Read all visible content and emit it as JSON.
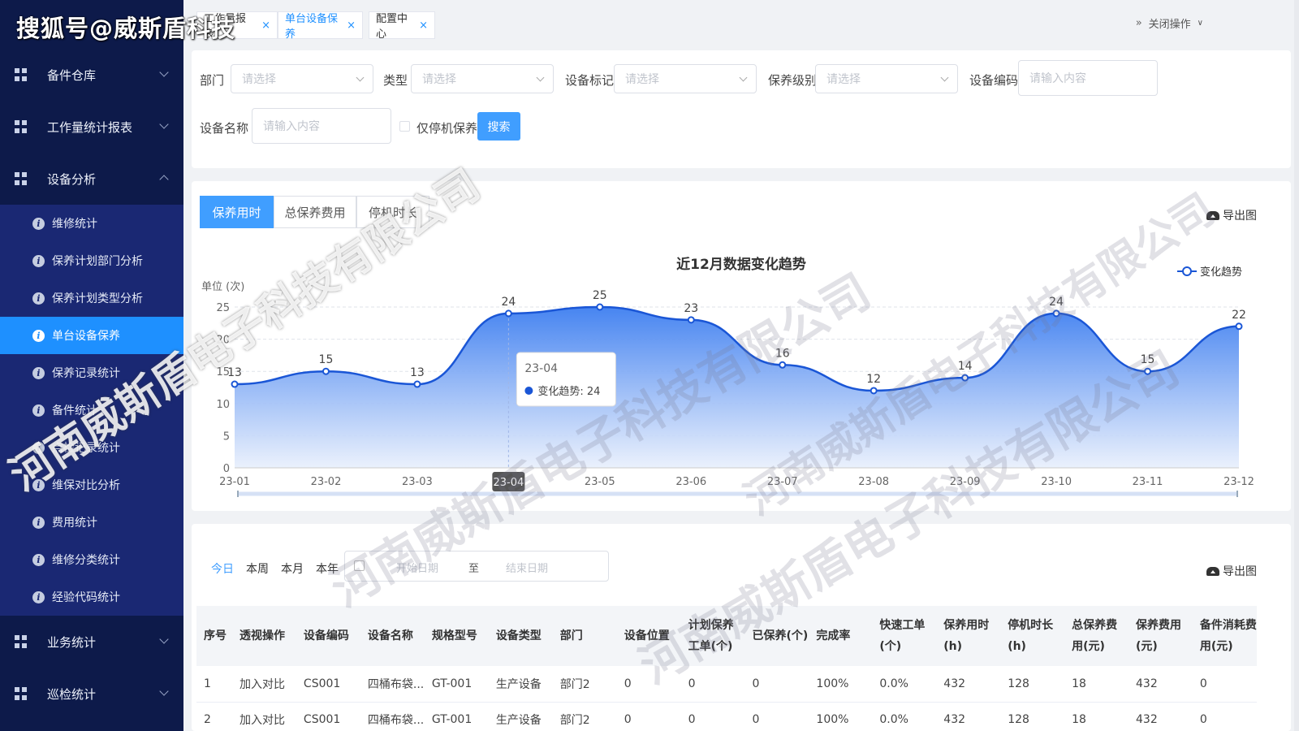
{
  "watermark": {
    "top_text": "搜狐号@威斯盾科技",
    "company_text": "河南威斯盾电子科技有限公司"
  },
  "sidebar": {
    "groups_top": [
      {
        "label": "备件仓库",
        "icon": "grid-icon"
      },
      {
        "label": "工作量统计报表",
        "icon": "grid-icon"
      },
      {
        "label": "设备分析",
        "icon": "grid-icon",
        "expanded": true
      }
    ],
    "sub_items": [
      {
        "label": "维修统计"
      },
      {
        "label": "保养计划部门分析"
      },
      {
        "label": "保养计划类型分析"
      },
      {
        "label": "单台设备保养",
        "active": true
      },
      {
        "label": "保养记录统计"
      },
      {
        "label": "备件统计"
      },
      {
        "label": "点检记录统计"
      },
      {
        "label": "维保对比分析"
      },
      {
        "label": "费用统计"
      },
      {
        "label": "维修分类统计"
      },
      {
        "label": "经验代码统计"
      }
    ],
    "groups_bottom": [
      {
        "label": "业务统计",
        "icon": "grid-icon"
      },
      {
        "label": "巡检统计",
        "icon": "grid-icon"
      }
    ]
  },
  "tabs": [
    {
      "label": "工作量报表",
      "closable": true
    },
    {
      "label": "单台设备保养",
      "closable": true,
      "current": true
    },
    {
      "label": "配置中心",
      "closable": true
    }
  ],
  "close_ops_label": "关闭操作",
  "filters": {
    "dept_label": "部门",
    "dept_placeholder": "请选择",
    "type_label": "类型",
    "type_placeholder": "请选择",
    "mark_label": "设备标记",
    "mark_placeholder": "请选择",
    "level_label": "保养级别",
    "level_placeholder": "请选择",
    "code_label": "设备编码",
    "code_placeholder": "请输入内容",
    "name_label": "设备名称",
    "name_placeholder": "请输入内容",
    "only_stop_label": "仅停机保养",
    "search_label": "搜索"
  },
  "chart_panel": {
    "tabs": [
      {
        "label": "保养用时",
        "active": true
      },
      {
        "label": "总保养费用"
      },
      {
        "label": "停机时长"
      }
    ],
    "export_label": "导出图",
    "tooltip_title": "23-04",
    "tooltip_row": "变化趋势: 24",
    "axis_pointer_label": "23-04",
    "accent": "#1a56d6",
    "fill_top": "#3d7ef0",
    "fill_bottom": "#e8effc"
  },
  "chart_data": {
    "type": "area",
    "title": "近12月数据变化趋势",
    "unit_label": "单位 (次)",
    "x": [
      "23-01",
      "23-02",
      "23-03",
      "23-04",
      "23-05",
      "23-06",
      "23-07",
      "23-08",
      "23-09",
      "23-10",
      "23-11",
      "23-12"
    ],
    "series": [
      {
        "name": "变化趋势",
        "values": [
          13,
          15,
          13,
          24,
          25,
          23,
          16,
          12,
          14,
          24,
          15,
          22
        ]
      }
    ],
    "yticks": [
      0,
      5,
      10,
      15,
      20,
      25
    ],
    "ylim": [
      0,
      25
    ],
    "smooth": true,
    "grid": "dashed-horizontal",
    "legend_position": "top-right"
  },
  "table_panel": {
    "range_tabs": [
      {
        "label": "今日",
        "active": true
      },
      {
        "label": "本周"
      },
      {
        "label": "本月"
      },
      {
        "label": "本年"
      }
    ],
    "start_placeholder": "开始日期",
    "to_label": "至",
    "end_placeholder": "结束日期",
    "export_label": "导出图",
    "headers": [
      "序号",
      "透视操作",
      "设备编码",
      "设备名称",
      "规格型号",
      "设备类型",
      "部门",
      "设备位置",
      "计划保养工单(个)",
      "已保养(个)",
      "完成率",
      "快速工单(个)",
      "保养用时(h)",
      "停机时长(h)",
      "总保养费用(元)",
      "保养费用(元)",
      "备件消耗费用(元)"
    ],
    "rows": [
      [
        "1",
        "加入对比",
        "CS001",
        "四桶布袋...",
        "GT-001",
        "生产设备",
        "部门2",
        "0",
        "0",
        "0",
        "100%",
        "0.0%",
        "432",
        "128",
        "18",
        "432",
        "0"
      ],
      [
        "2",
        "加入对比",
        "CS001",
        "四桶布袋...",
        "GT-001",
        "生产设备",
        "部门2",
        "0",
        "0",
        "0",
        "100%",
        "0.0%",
        "432",
        "128",
        "18",
        "432",
        "0"
      ]
    ]
  }
}
